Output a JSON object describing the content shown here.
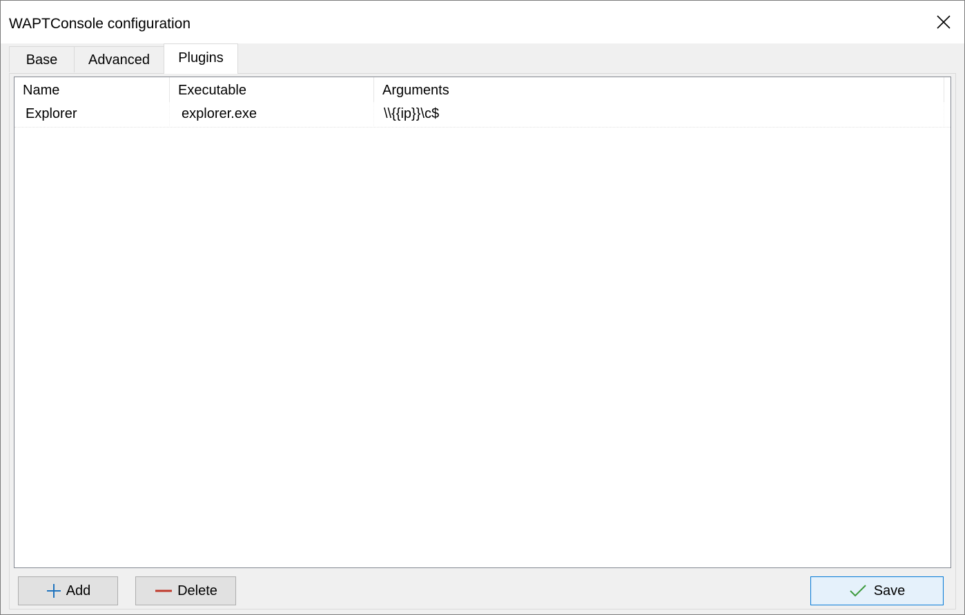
{
  "window": {
    "title": "WAPTConsole configuration",
    "close_icon": "close-icon"
  },
  "tabs": [
    {
      "label": "Base",
      "selected": false
    },
    {
      "label": "Advanced",
      "selected": false
    },
    {
      "label": "Plugins",
      "selected": true
    }
  ],
  "plugins_table": {
    "columns": [
      "Name",
      "Executable",
      "Arguments"
    ],
    "rows": [
      {
        "name": "Explorer",
        "executable": "explorer.exe",
        "arguments": "\\\\{{ip}}\\c$"
      }
    ]
  },
  "buttons": {
    "add": {
      "label": "Add",
      "icon": "plus-icon",
      "icon_color": "#1e73be"
    },
    "delete": {
      "label": "Delete",
      "icon": "minus-icon",
      "icon_color": "#c0392b"
    },
    "save": {
      "label": "Save",
      "icon": "checkmark-icon",
      "icon_color": "#3c9a3c"
    }
  },
  "colors": {
    "window_bg": "#f0f0f0",
    "accent_border": "#0078d7",
    "save_bg": "#e5f1fb"
  }
}
